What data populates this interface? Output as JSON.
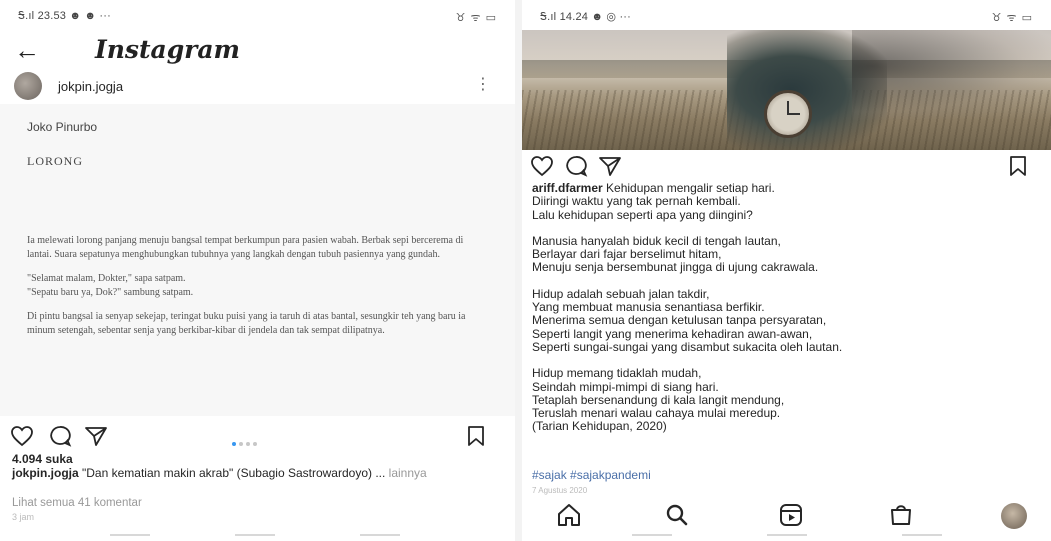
{
  "left": {
    "status": {
      "left": "Ꭶ.ıl 23.53 ☻ ☻ ···",
      "right": "♉ ᯤ ▭"
    },
    "header": {
      "brand": "Instagram"
    },
    "post": {
      "username": "jokpin.jogja",
      "image": {
        "author": "Joko Pinurbo",
        "title": "LORONG",
        "paragraphs": [
          "Ia melewati lorong panjang menuju bangsal tempat berkumpun para pasien wabah. Berbak sepi bercerema di lantai. Suara sepatunya menghubungkan tubuhnya yang langkah dengan tubuh pasiennya yang gundah.",
          "\"Selamat malam, Dokter,\" sapa satpam.\n\"Sepatu baru ya, Dok?\" sambung satpam.",
          "Di pintu bangsal ia senyap sekejap, teringat buku puisi yang ia taruh di atas bantal, sesungkir teh yang baru ia minum setengah, sebentar senja yang berkibar-kibar di jendela dan tak sempat dilipatnya."
        ]
      },
      "likes": "4.094 suka",
      "caption_user": "jokpin.jogja",
      "caption_text": " \"Dan kematian makin akrab\" (Subagio Sastrowardoyo) ...",
      "caption_more": " lainnya",
      "comments_link": "Lihat semua 41 komentar",
      "time_ago": "3 jam"
    }
  },
  "right": {
    "status": {
      "left": "Ꭶ.ıl 14.24 ☻ ◎ ···",
      "right": "♉ ᯤ ▭"
    },
    "caption": {
      "user": "ariff.dfarmer",
      "paragraphs": [
        " Kehidupan mengalir setiap hari.\nDiiringi waktu yang tak pernah kembali.\nLalu kehidupan seperti apa yang diingini?",
        "Manusia hanyalah biduk kecil di tengah lautan,\nBerlayar dari fajar berselimut hitam,\nMenuju senja bersembunat jingga di ujung cakrawala.",
        "Hidup adalah sebuah jalan takdir,\nYang membuat manusia senantiasa berfikir.\nMenerima semua dengan ketulusan tanpa persyaratan,\nSeperti langit yang menerima kehadiran awan-awan,\nSeperti sungai-sungai yang disambut sukacita oleh lautan.",
        "Hidup memang tidaklah mudah,\nSeindah mimpi-mimpi di siang hari.\nTetaplah bersenandung di kala langit mendung,\nTeruslah menari walau cahaya mulai meredup.\n(Tarian Kehidupan, 2020)"
      ],
      "hashtags": "#sajak #sajakpandemi",
      "date": "7 Agustus 2020"
    }
  },
  "icons": {
    "like": "heart-icon",
    "comment": "comment-icon",
    "share": "send-icon",
    "save": "bookmark-icon",
    "home": "home-icon",
    "search": "search-icon",
    "reels": "reels-icon",
    "shop": "shop-icon"
  },
  "colors": {
    "link": "#4a6fa8",
    "muted": "#999999",
    "carousel_active": "#3897f0"
  }
}
